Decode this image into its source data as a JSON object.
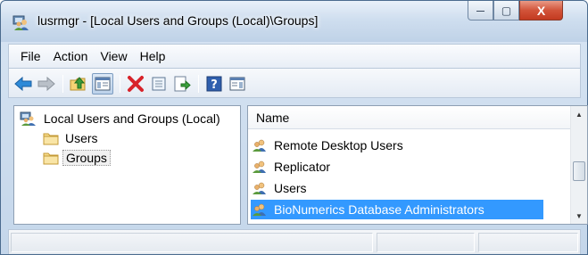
{
  "window": {
    "title": "lusrmgr - [Local Users and Groups (Local)\\Groups]",
    "caption_buttons": {
      "minimize": "—",
      "maximize": "▢",
      "close": "X"
    }
  },
  "menubar": {
    "items": [
      "File",
      "Action",
      "View",
      "Help"
    ]
  },
  "toolbar": {
    "buttons": [
      {
        "icon": "back-arrow-icon"
      },
      {
        "icon": "forward-arrow-icon"
      },
      {
        "icon": "up-folder-icon"
      },
      {
        "icon": "show-hide-console-tree-icon",
        "active": true
      },
      {
        "icon": "delete-icon"
      },
      {
        "icon": "properties-icon"
      },
      {
        "icon": "export-list-icon"
      },
      {
        "icon": "help-icon"
      },
      {
        "icon": "show-hide-action-pane-icon"
      }
    ]
  },
  "tree": {
    "root": {
      "label": "Local Users and Groups (Local)",
      "icon": "computer-users-icon"
    },
    "children": [
      {
        "label": "Users",
        "icon": "folder-icon",
        "selected": false
      },
      {
        "label": "Groups",
        "icon": "folder-icon",
        "selected": true
      }
    ]
  },
  "list": {
    "columns": [
      {
        "label": "Name"
      },
      {
        "label": ""
      }
    ],
    "rows": [
      {
        "name": "Remote Desktop Users",
        "icon": "group-icon",
        "selected": false
      },
      {
        "name": "Replicator",
        "icon": "group-icon",
        "selected": false
      },
      {
        "name": "Users",
        "icon": "group-icon",
        "selected": false
      },
      {
        "name": "BioNumerics Database Administrators",
        "icon": "group-icon",
        "selected": true
      }
    ],
    "scrollbar": {
      "arrow_up": "▲",
      "arrow_down": "▼"
    }
  },
  "colors": {
    "selection": "#3399ff",
    "close_button": "#c33a20"
  }
}
